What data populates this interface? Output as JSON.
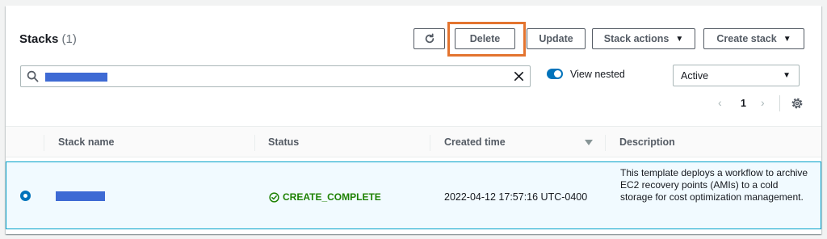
{
  "header": {
    "title": "Stacks",
    "count": "(1)"
  },
  "toolbar": {
    "delete_label": "Delete",
    "update_label": "Update",
    "stack_actions_label": "Stack actions",
    "create_stack_label": "Create stack"
  },
  "search": {
    "value": "redacted"
  },
  "view_nested": {
    "label": "View nested",
    "enabled": true
  },
  "filter": {
    "selected": "Active"
  },
  "pagination": {
    "current_page": "1"
  },
  "table": {
    "columns": [
      "Stack name",
      "Status",
      "Created time",
      "Description"
    ],
    "rows": [
      {
        "stack_name": "redacted",
        "status": "CREATE_COMPLETE",
        "created_time": "2022-04-12 17:57:16 UTC-0400",
        "description": "This template deploys a workflow to archive EC2 recovery points (AMIs) to a cold storage for cost optimization management.",
        "selected": true
      }
    ]
  },
  "colors": {
    "accent": "#0073bb",
    "success": "#1d8102",
    "highlight": "#e3742f",
    "redaction": "#3e6ad4"
  },
  "icons": [
    "refresh-icon",
    "search-icon",
    "close-icon",
    "chevron-left-icon",
    "chevron-right-icon",
    "gear-icon",
    "sort-icon",
    "check-circle-icon"
  ]
}
